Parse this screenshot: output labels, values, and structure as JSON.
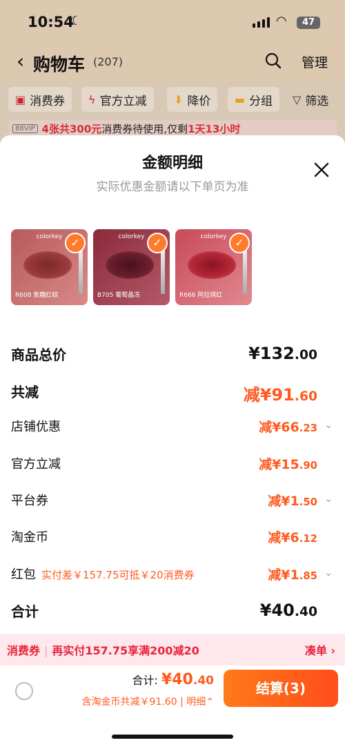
{
  "status_bar": {
    "time": "10:54",
    "battery": "47"
  },
  "nav": {
    "title": "购物车",
    "count": "(207)",
    "manage": "管理"
  },
  "filters": [
    {
      "icon": "coupon-icon",
      "label": "消费券"
    },
    {
      "icon": "lightning-icon",
      "label": "官方立减"
    },
    {
      "icon": "price-down-icon",
      "label": "降价"
    },
    {
      "icon": "folder-icon",
      "label": "分组"
    },
    {
      "icon": "filter-icon",
      "label": "筛选"
    }
  ],
  "vip_banner": {
    "tag": "88VIP",
    "count_text": "4张共300元",
    "mid_text": "消费券待使用,仅剩",
    "time_left": "1天13小时"
  },
  "sheet": {
    "title": "金额明细",
    "subtitle": "实际优惠金额请以下单页为准",
    "products": [
      {
        "brand": "colorkey",
        "caption": "R608 焦糖红棕",
        "color": "#9a3a3c"
      },
      {
        "brand": "colorkey",
        "caption": "B705 葡萄晶冻",
        "color": "#6a1f2c"
      },
      {
        "brand": "colorkey",
        "caption": "R666 阿拉琪红",
        "color": "#b52837"
      }
    ],
    "rows": [
      {
        "label": "商品总价",
        "amount_int": "¥132",
        "amount_dec": ".00"
      },
      {
        "label": "共减",
        "amount_int": "减¥91",
        "amount_dec": ".60"
      },
      {
        "label": "店铺优惠",
        "amount_int": "减¥66",
        "amount_dec": ".23"
      },
      {
        "label": "官方立减",
        "amount_int": "减¥15",
        "amount_dec": ".90"
      },
      {
        "label": "平台券",
        "amount_int": "减¥1",
        "amount_dec": ".50"
      },
      {
        "label": "淘金币",
        "amount_int": "减¥6",
        "amount_dec": ".12"
      },
      {
        "label": "红包",
        "note": "实付差￥157.75可抵￥20消费券",
        "amount_int": "减¥1",
        "amount_dec": ".85"
      },
      {
        "label": "合计",
        "amount_int": "¥40",
        "amount_dec": ".40"
      }
    ]
  },
  "promo": {
    "label": "消费券",
    "text": "再实付157.75享满200减20",
    "action": "凑单"
  },
  "footer": {
    "total_label": "合计: ",
    "total_int": "¥40",
    "total_dec": ".40",
    "saved_text": "含淘金币共减￥91.60",
    "detail_label": "明细",
    "checkout_label": "结算(3)"
  },
  "colors": {
    "accent": "#ff5a1f",
    "promo_red": "#e8243c",
    "check": "#ff7a2a"
  }
}
